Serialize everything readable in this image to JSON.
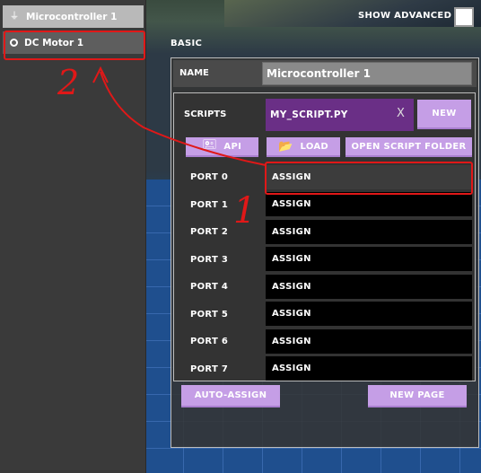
{
  "hierarchy": {
    "items": [
      {
        "label": "Microcontroller 1",
        "icon": "plug-icon"
      },
      {
        "label": "DC Motor 1",
        "icon": "radio-dot-icon"
      }
    ]
  },
  "header": {
    "show_advanced_label": "SHOW ADVANCED",
    "show_advanced_checked": false
  },
  "panel": {
    "section_label": "BASIC",
    "name_label": "NAME",
    "name_value": "Microcontroller 1",
    "scripts_label": "SCRIPTS",
    "script_value": "MY_SCRIPT.PY",
    "script_clear": "X",
    "buttons": {
      "new": "NEW",
      "api": "API",
      "load": "LOAD",
      "open_folder": "OPEN SCRIPT FOLDER",
      "auto_assign": "AUTO-ASSIGN",
      "new_page": "NEW PAGE"
    },
    "ports": [
      {
        "label": "PORT 0",
        "value": "ASSIGN"
      },
      {
        "label": "PORT 1",
        "value": "ASSIGN"
      },
      {
        "label": "PORT 2",
        "value": "ASSIGN"
      },
      {
        "label": "PORT 3",
        "value": "ASSIGN"
      },
      {
        "label": "PORT 4",
        "value": "ASSIGN"
      },
      {
        "label": "PORT 5",
        "value": "ASSIGN"
      },
      {
        "label": "PORT 6",
        "value": "ASSIGN"
      },
      {
        "label": "PORT 7",
        "value": "ASSIGN"
      }
    ]
  },
  "annotations": {
    "step_one": "1",
    "step_two": "2",
    "color": "#e01818"
  },
  "colors": {
    "accent_button": "#c59ee6",
    "script_field": "#6a2f86",
    "panel": "#333333"
  }
}
